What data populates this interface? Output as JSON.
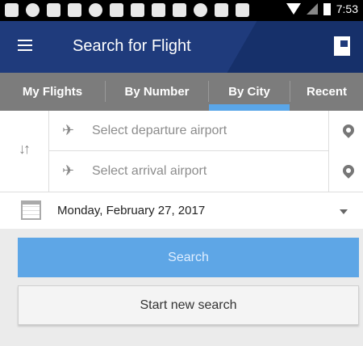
{
  "status_bar": {
    "time": "7:53",
    "icons": [
      "message-icon",
      "headset-icon",
      "facebook-icon",
      "bank-icon",
      "half-circle-icon",
      "facebook-icon",
      "usa-today-icon",
      "link-icon",
      "keyboard-icon",
      "compass-icon",
      "wrench-icon",
      "video-icon",
      "wifi-icon",
      "signal-icon",
      "battery-icon"
    ]
  },
  "header": {
    "title": "Search for Flight",
    "menu_icon": "hamburger-menu-icon",
    "right_icon": "flag-icon"
  },
  "tabs": [
    {
      "label": "My Flights",
      "active": false
    },
    {
      "label": "By Number",
      "active": false
    },
    {
      "label": "By City",
      "active": true
    },
    {
      "label": "Recent",
      "active": false
    }
  ],
  "form": {
    "swap_icon": "swap-icon",
    "departure_placeholder": "Select departure airport",
    "arrival_placeholder": "Select arrival airport",
    "departure_icon": "takeoff-icon",
    "arrival_icon": "landing-icon",
    "location_icon": "location-pin-icon",
    "date": "Monday, February 27, 2017",
    "calendar_icon": "calendar-icon",
    "dropdown_icon": "caret-down-icon"
  },
  "buttons": {
    "search": "Search",
    "new_search": "Start new search"
  },
  "colors": {
    "status_bar": "#000000",
    "header": "#1f3b7c",
    "tab_bar": "#7c7c7c",
    "tab_indicator": "#5aa6e8",
    "search_button": "#5ea6e6",
    "page_background": "#ebebeb"
  }
}
